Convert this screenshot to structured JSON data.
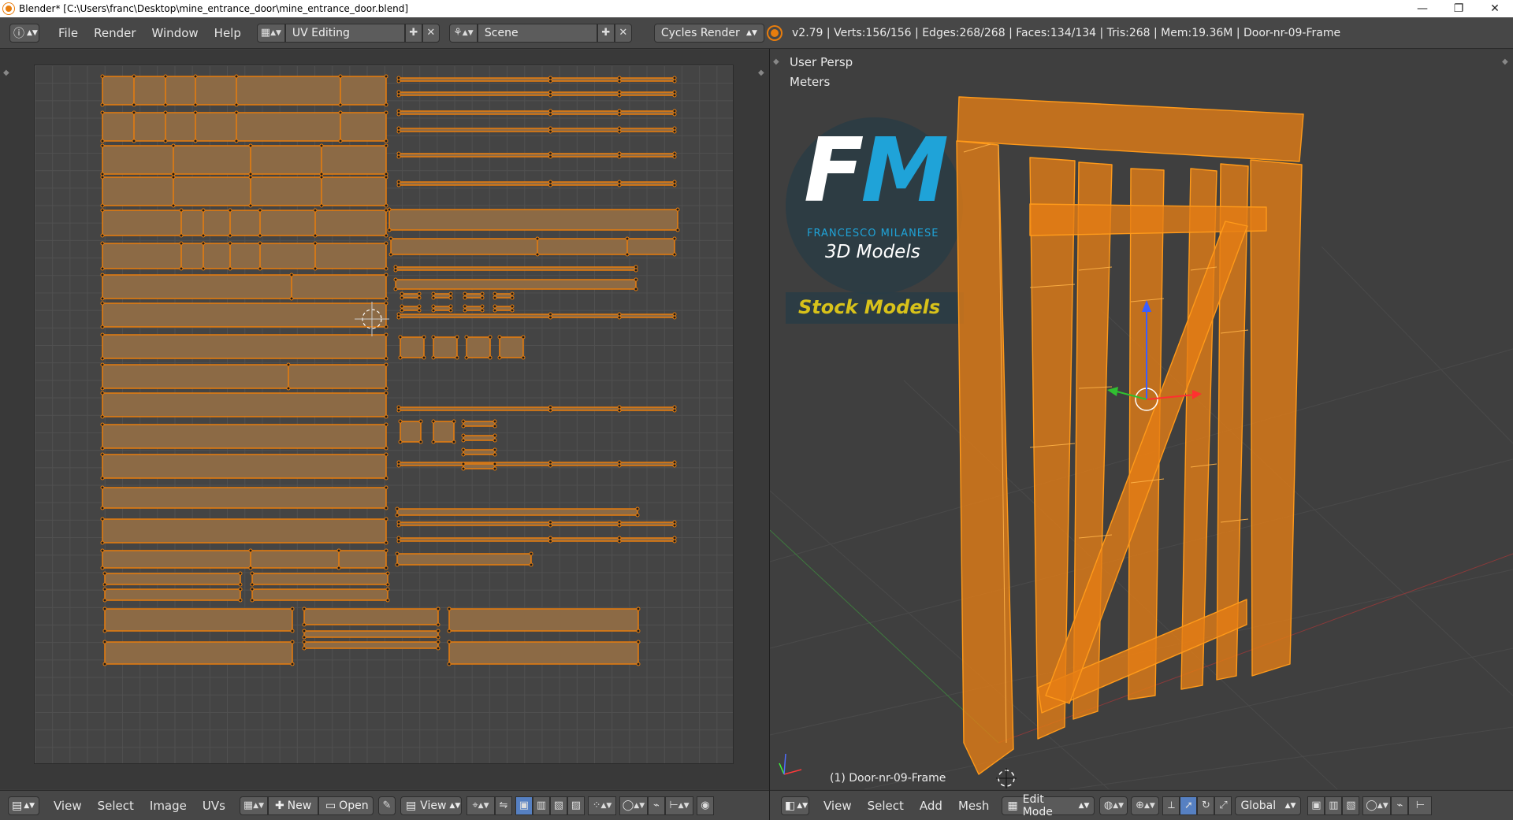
{
  "titlebar": {
    "title": "Blender* [C:\\Users\\franc\\Desktop\\mine_entrance_door\\mine_entrance_door.blend]",
    "minimize": "—",
    "maximize": "❐",
    "close": "✕"
  },
  "infobar": {
    "menus": [
      "File",
      "Render",
      "Window",
      "Help"
    ],
    "layout": "UV Editing",
    "scene": "Scene",
    "engine": "Cycles Render",
    "stats": "v2.79 | Verts:156/156 | Edges:268/268 | Faces:134/134 | Tris:268 | Mem:19.36M | Door-nr-09-Frame"
  },
  "uv_editor": {
    "footer": {
      "menus": [
        "View",
        "Select",
        "Image",
        "UVs"
      ],
      "new_label": "New",
      "open_label": "Open",
      "view_label": "View"
    }
  },
  "viewport": {
    "view_label": "User Persp",
    "units_label": "Meters",
    "object_label": "(1) Door-nr-09-Frame",
    "logo": {
      "letters_f": "F",
      "letters_m": "M",
      "name": "FRANCESCO MILANESE",
      "tagline": "3D Models",
      "stock": "Stock Models"
    },
    "footer": {
      "menus": [
        "View",
        "Select",
        "Add",
        "Mesh"
      ],
      "mode": "Edit Mode",
      "orientation": "Global"
    }
  },
  "colors": {
    "orange": "#e87d0d",
    "uv_fill": "#8c6a45",
    "logo_blue": "#1fa3d8",
    "stock_yellow": "#d8c21a"
  }
}
